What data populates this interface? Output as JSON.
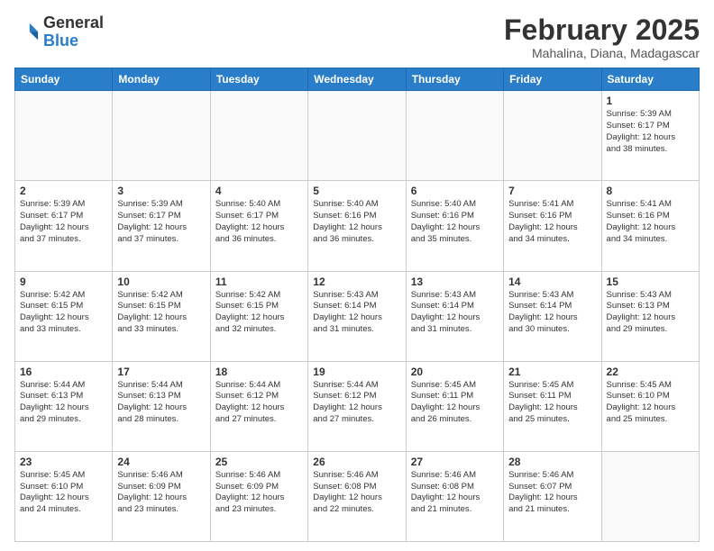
{
  "header": {
    "logo_line1": "General",
    "logo_line2": "Blue",
    "month": "February 2025",
    "location": "Mahalina, Diana, Madagascar"
  },
  "days_of_week": [
    "Sunday",
    "Monday",
    "Tuesday",
    "Wednesday",
    "Thursday",
    "Friday",
    "Saturday"
  ],
  "weeks": [
    [
      {
        "day": "",
        "info": ""
      },
      {
        "day": "",
        "info": ""
      },
      {
        "day": "",
        "info": ""
      },
      {
        "day": "",
        "info": ""
      },
      {
        "day": "",
        "info": ""
      },
      {
        "day": "",
        "info": ""
      },
      {
        "day": "1",
        "info": "Sunrise: 5:39 AM\nSunset: 6:17 PM\nDaylight: 12 hours\nand 38 minutes."
      }
    ],
    [
      {
        "day": "2",
        "info": "Sunrise: 5:39 AM\nSunset: 6:17 PM\nDaylight: 12 hours\nand 37 minutes."
      },
      {
        "day": "3",
        "info": "Sunrise: 5:39 AM\nSunset: 6:17 PM\nDaylight: 12 hours\nand 37 minutes."
      },
      {
        "day": "4",
        "info": "Sunrise: 5:40 AM\nSunset: 6:17 PM\nDaylight: 12 hours\nand 36 minutes."
      },
      {
        "day": "5",
        "info": "Sunrise: 5:40 AM\nSunset: 6:16 PM\nDaylight: 12 hours\nand 36 minutes."
      },
      {
        "day": "6",
        "info": "Sunrise: 5:40 AM\nSunset: 6:16 PM\nDaylight: 12 hours\nand 35 minutes."
      },
      {
        "day": "7",
        "info": "Sunrise: 5:41 AM\nSunset: 6:16 PM\nDaylight: 12 hours\nand 34 minutes."
      },
      {
        "day": "8",
        "info": "Sunrise: 5:41 AM\nSunset: 6:16 PM\nDaylight: 12 hours\nand 34 minutes."
      }
    ],
    [
      {
        "day": "9",
        "info": "Sunrise: 5:42 AM\nSunset: 6:15 PM\nDaylight: 12 hours\nand 33 minutes."
      },
      {
        "day": "10",
        "info": "Sunrise: 5:42 AM\nSunset: 6:15 PM\nDaylight: 12 hours\nand 33 minutes."
      },
      {
        "day": "11",
        "info": "Sunrise: 5:42 AM\nSunset: 6:15 PM\nDaylight: 12 hours\nand 32 minutes."
      },
      {
        "day": "12",
        "info": "Sunrise: 5:43 AM\nSunset: 6:14 PM\nDaylight: 12 hours\nand 31 minutes."
      },
      {
        "day": "13",
        "info": "Sunrise: 5:43 AM\nSunset: 6:14 PM\nDaylight: 12 hours\nand 31 minutes."
      },
      {
        "day": "14",
        "info": "Sunrise: 5:43 AM\nSunset: 6:14 PM\nDaylight: 12 hours\nand 30 minutes."
      },
      {
        "day": "15",
        "info": "Sunrise: 5:43 AM\nSunset: 6:13 PM\nDaylight: 12 hours\nand 29 minutes."
      }
    ],
    [
      {
        "day": "16",
        "info": "Sunrise: 5:44 AM\nSunset: 6:13 PM\nDaylight: 12 hours\nand 29 minutes."
      },
      {
        "day": "17",
        "info": "Sunrise: 5:44 AM\nSunset: 6:13 PM\nDaylight: 12 hours\nand 28 minutes."
      },
      {
        "day": "18",
        "info": "Sunrise: 5:44 AM\nSunset: 6:12 PM\nDaylight: 12 hours\nand 27 minutes."
      },
      {
        "day": "19",
        "info": "Sunrise: 5:44 AM\nSunset: 6:12 PM\nDaylight: 12 hours\nand 27 minutes."
      },
      {
        "day": "20",
        "info": "Sunrise: 5:45 AM\nSunset: 6:11 PM\nDaylight: 12 hours\nand 26 minutes."
      },
      {
        "day": "21",
        "info": "Sunrise: 5:45 AM\nSunset: 6:11 PM\nDaylight: 12 hours\nand 25 minutes."
      },
      {
        "day": "22",
        "info": "Sunrise: 5:45 AM\nSunset: 6:10 PM\nDaylight: 12 hours\nand 25 minutes."
      }
    ],
    [
      {
        "day": "23",
        "info": "Sunrise: 5:45 AM\nSunset: 6:10 PM\nDaylight: 12 hours\nand 24 minutes."
      },
      {
        "day": "24",
        "info": "Sunrise: 5:46 AM\nSunset: 6:09 PM\nDaylight: 12 hours\nand 23 minutes."
      },
      {
        "day": "25",
        "info": "Sunrise: 5:46 AM\nSunset: 6:09 PM\nDaylight: 12 hours\nand 23 minutes."
      },
      {
        "day": "26",
        "info": "Sunrise: 5:46 AM\nSunset: 6:08 PM\nDaylight: 12 hours\nand 22 minutes."
      },
      {
        "day": "27",
        "info": "Sunrise: 5:46 AM\nSunset: 6:08 PM\nDaylight: 12 hours\nand 21 minutes."
      },
      {
        "day": "28",
        "info": "Sunrise: 5:46 AM\nSunset: 6:07 PM\nDaylight: 12 hours\nand 21 minutes."
      },
      {
        "day": "",
        "info": ""
      }
    ]
  ]
}
